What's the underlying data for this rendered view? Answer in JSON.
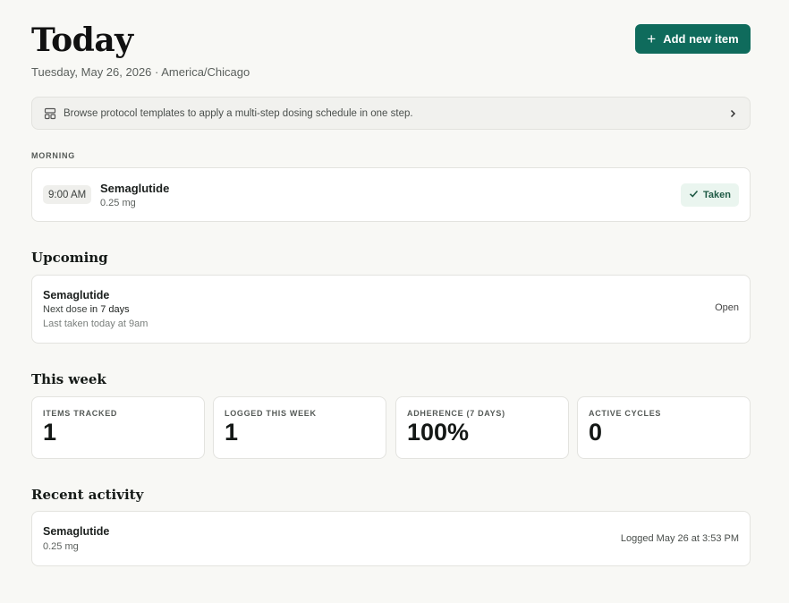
{
  "header": {
    "title": "Today",
    "subtitle": "Tuesday, May 26, 2026 · America/Chicago",
    "add_button_label": "Add new item",
    "add_button_icon": "plus-icon"
  },
  "banner": {
    "text": "Browse protocol templates to apply a multi-step dosing schedule in one step.",
    "icon": "template-grid-icon",
    "chevron_icon": "chevron-right-icon"
  },
  "morning": {
    "label": "MORNING",
    "dose": {
      "time": "9:00 AM",
      "name": "Semaglutide",
      "amount": "0.25 mg",
      "status": "Taken",
      "status_icon": "check-icon"
    }
  },
  "upcoming": {
    "heading": "Upcoming",
    "item": {
      "name": "Semaglutide",
      "next_prefix": "Next dose",
      "next_value": "in 7 days",
      "last_taken": "Last taken today at 9am",
      "action": "Open"
    }
  },
  "this_week": {
    "heading": "This week",
    "stats": [
      {
        "label": "ITEMS TRACKED",
        "value": "1"
      },
      {
        "label": "LOGGED THIS WEEK",
        "value": "1"
      },
      {
        "label": "ADHERENCE (7 DAYS)",
        "value": "100%"
      },
      {
        "label": "ACTIVE CYCLES",
        "value": "0"
      }
    ]
  },
  "recent": {
    "heading": "Recent activity",
    "item": {
      "name": "Semaglutide",
      "amount": "0.25 mg",
      "timestamp": "Logged May 26 at 3:53 PM"
    }
  },
  "colors": {
    "accent": "#0f6b5c",
    "background": "#f8f8f5",
    "taken_badge_bg": "#eaf5ef",
    "taken_badge_text": "#1f5a45"
  }
}
